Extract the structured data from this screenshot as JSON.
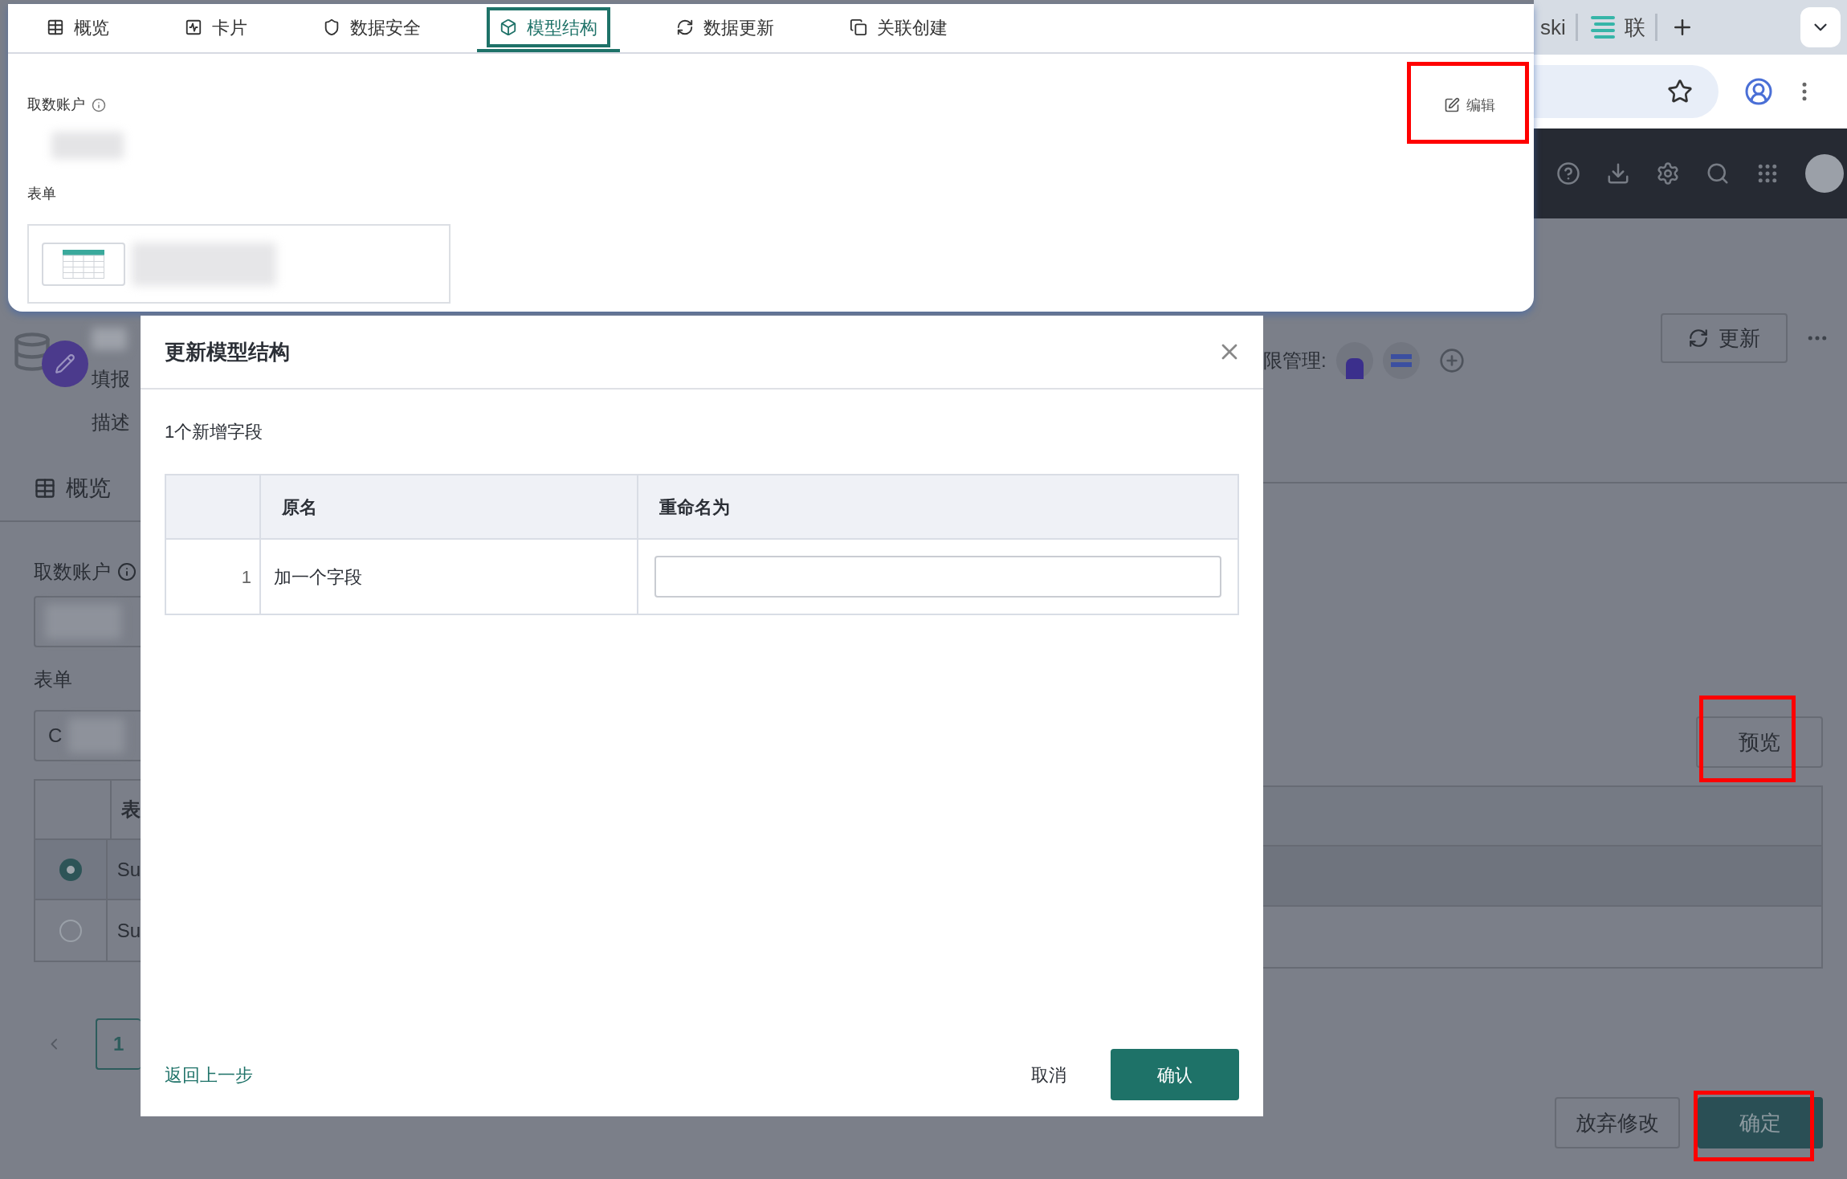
{
  "browser": {
    "tabs": [
      {
        "label": "ski"
      },
      {
        "label": "联"
      }
    ]
  },
  "app_page": {
    "info_lines": [
      "填报",
      "描述"
    ],
    "permission_label": "限管理:",
    "update_button": "更新",
    "tab": "概览",
    "account_label": "取数账户",
    "form_label": "表单",
    "form_select": "C",
    "preview_button": "预览",
    "table": {
      "header": "表",
      "rows": [
        {
          "name": "Su",
          "selected": true
        },
        {
          "name": "Su",
          "selected": false
        }
      ]
    },
    "pagination": [
      {
        "label": "1",
        "selected": true
      }
    ],
    "buttons": [
      {
        "label": "放弃修改",
        "kind": "secondary"
      },
      {
        "label": "确定",
        "kind": "primary"
      }
    ]
  },
  "top_panel": {
    "tabs": [
      {
        "label": "概览",
        "selected": false
      },
      {
        "label": "卡片",
        "selected": false
      },
      {
        "label": "数据安全",
        "selected": false
      },
      {
        "label": "模型结构",
        "selected": true
      },
      {
        "label": "数据更新",
        "selected": false
      },
      {
        "label": "关联创建",
        "selected": false
      }
    ],
    "account_label": "取数账户",
    "form_label": "表单",
    "edit_button": "编辑"
  },
  "dialog": {
    "title": "更新模型结构",
    "summary": "1个新增字段",
    "columns": [
      "原名",
      "重命名为"
    ],
    "rows": [
      {
        "index": "1",
        "name": "加一个字段"
      }
    ],
    "back_link": "返回上一步",
    "cancel": "取消",
    "confirm": "确认"
  }
}
